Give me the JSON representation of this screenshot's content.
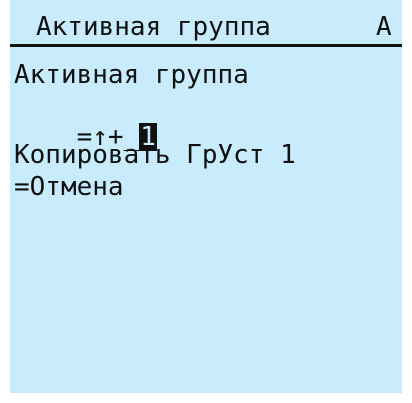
{
  "header": {
    "title": "Активная группа",
    "overflow_text": "А"
  },
  "menu": {
    "heading": "Активная группа",
    "edit_prefix": "=↑+_",
    "edit_value": "1",
    "copy_label": "Копировать ГрУст 1",
    "cancel_label": "=Отмена"
  },
  "colors": {
    "screen_background": "#c8ecfb",
    "text": "#111111",
    "cursor_background": "#111111"
  }
}
